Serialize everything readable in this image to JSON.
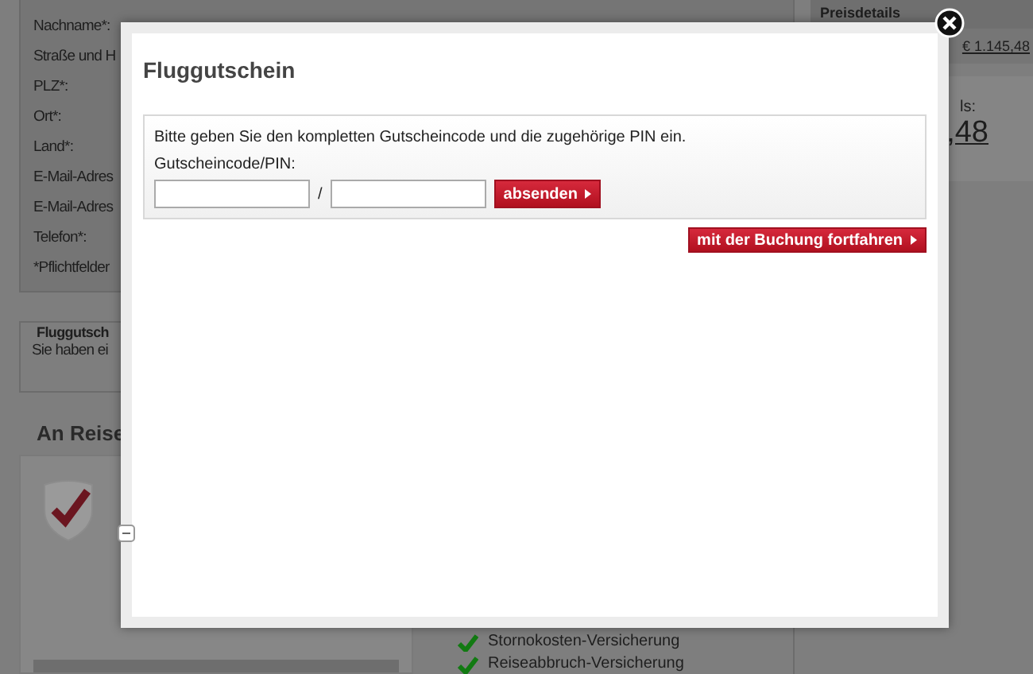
{
  "booking_form": {
    "labels": [
      "Nachname*:",
      "Straße und H",
      "PLZ*:",
      "Ort*:",
      "Land*:",
      "E-Mail-Adres",
      "E-Mail-Adres",
      "Telefon*:"
    ],
    "required_note": "*Pflichtfelder"
  },
  "voucher_section": {
    "title": "Fluggutsch",
    "text": "Sie haben ei"
  },
  "travel_section": {
    "title": "An Reise",
    "insurance_items": [
      "Stornokosten-Versicherung",
      "Reiseabbruch-Versicherung"
    ]
  },
  "price_panel": {
    "title": "Preisdetails",
    "amount": "€ 1.145,48",
    "total_label": "ls:",
    "total": ",48"
  },
  "dialog": {
    "title": "Fluggutschein",
    "instruction": "Bitte geben Sie den kompletten Gutscheincode und die zugehörige PIN ein.",
    "field_label": "Gutscheincode/PIN:",
    "separator": "/",
    "submit_button": "absenden",
    "continue_button": "mit der Buchung fortfahren"
  }
}
